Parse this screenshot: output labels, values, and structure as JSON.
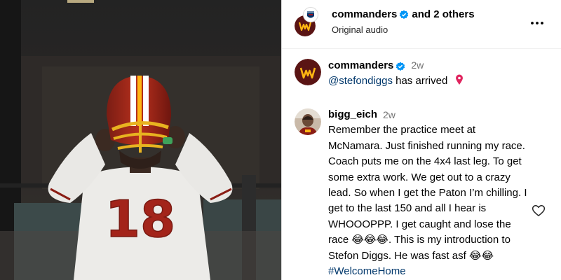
{
  "media": {
    "jersey_number": "18"
  },
  "post_header": {
    "username": "commanders",
    "others_text": "and 2 others",
    "audio_label": "Original audio"
  },
  "caption": {
    "username": "commanders",
    "time": "2w",
    "mention": "@stefondiggs",
    "text": "has arrived"
  },
  "comment": {
    "username": "bigg_eich",
    "time": "2w",
    "text_before_emoji": "Remember the practice meet at McNamara. Just finished running my race. Coach puts me on the 4x4 last leg. To get some extra work. We get out to a crazy lead. So when I get the Paton I’m chilling. I get to the last 150 and all I hear is WHOOOPPP. I get caught and lose the race",
    "emoji_1": "😂😂😂",
    "text_after_emoji": ". This is my introduction to Stefon Diggs. He was fast asf",
    "emoji_2": "😂😂",
    "hashtag": "#WelcomeHome"
  },
  "colors": {
    "burgundy": "#5a1414",
    "gold": "#ffb612",
    "verified_blue": "#0095f6",
    "link": "#00376b"
  }
}
